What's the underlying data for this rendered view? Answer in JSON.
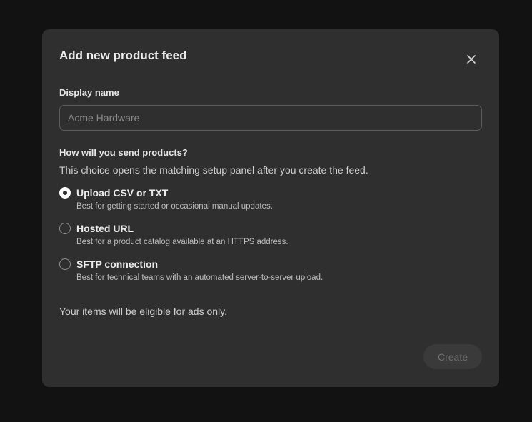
{
  "dialog": {
    "title": "Add new product feed",
    "close_icon": "close-icon",
    "display_name": {
      "label": "Display name",
      "value": "",
      "placeholder": "Acme Hardware"
    },
    "method": {
      "question": "How will you send products?",
      "description": "This choice opens the matching setup panel after you create the feed.",
      "options": [
        {
          "label": "Upload CSV or TXT",
          "description": "Best for getting started or occasional manual updates.",
          "selected": true
        },
        {
          "label": "Hosted URL",
          "description": "Best for a product catalog available at an HTTPS address.",
          "selected": false
        },
        {
          "label": "SFTP connection",
          "description": "Best for technical teams with an automated server-to-server upload.",
          "selected": false
        }
      ]
    },
    "note": "Your items will be eligible for ads only.",
    "create_label": "Create",
    "create_disabled": true
  },
  "colors": {
    "backdrop": "#121212",
    "dialog_bg": "#2f2f2f",
    "text": "#ececec",
    "muted": "#bdbdbd",
    "disabled_button": "#3a3a3a"
  }
}
